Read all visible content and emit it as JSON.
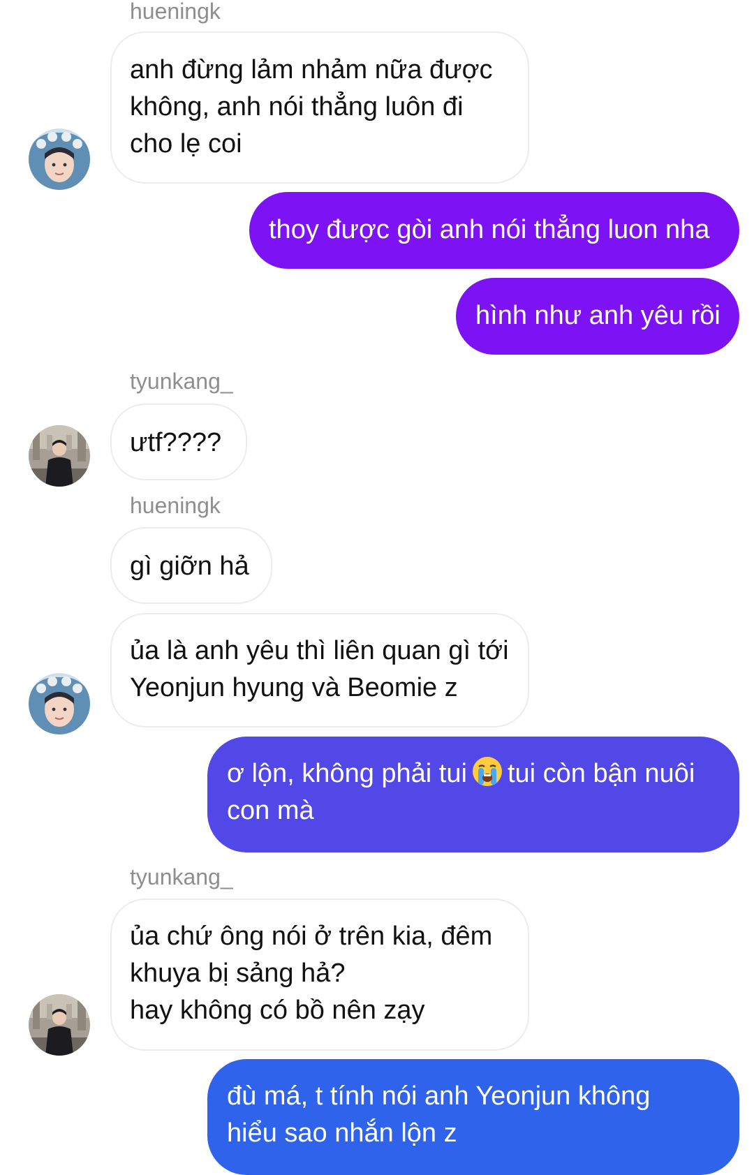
{
  "colors": {
    "purple": "#7d12f5",
    "violet": "#5248e8",
    "blue": "#2f63ec",
    "incoming_bg": "#ffffff",
    "incoming_border": "#ececec",
    "sender_name": "#8e8e8e"
  },
  "conversation": {
    "senders": {
      "s1": "hueningk",
      "s2": "tyunkang_",
      "s3": "hueningk",
      "s4": "tyunkang_"
    },
    "messages": {
      "m1": {
        "lines": [
          "anh đừng lảm nhảm nữa được",
          "không, anh nói thẳng luôn đi",
          "cho lẹ coi"
        ]
      },
      "m2": {
        "text": "thoy được gòi anh nói thẳng luon nha"
      },
      "m3": {
        "text": "hình như anh yêu rồi"
      },
      "m4": {
        "text": "ưtf????"
      },
      "m5": {
        "text": "gì giỡn hả"
      },
      "m6": {
        "lines": [
          "ủa là anh yêu thì liên quan gì tới",
          "Yeonjun hyung và Beomie z"
        ]
      },
      "m7": {
        "line1_a": "ơ lộn, không phải tui",
        "emoji": "loudly-crying-face",
        "line1_b": "tui còn bận nuôi",
        "line2": "con mà"
      },
      "m8": {
        "lines": [
          "ủa chứ ông nói ở trên kia, đêm",
          "khuya bị sảng hả?",
          "hay không có bồ nên zạy"
        ]
      },
      "m9": {
        "lines": [
          "đù má, t tính nói anh Yeonjun không",
          "hiểu sao nhắn lộn z"
        ]
      }
    }
  }
}
